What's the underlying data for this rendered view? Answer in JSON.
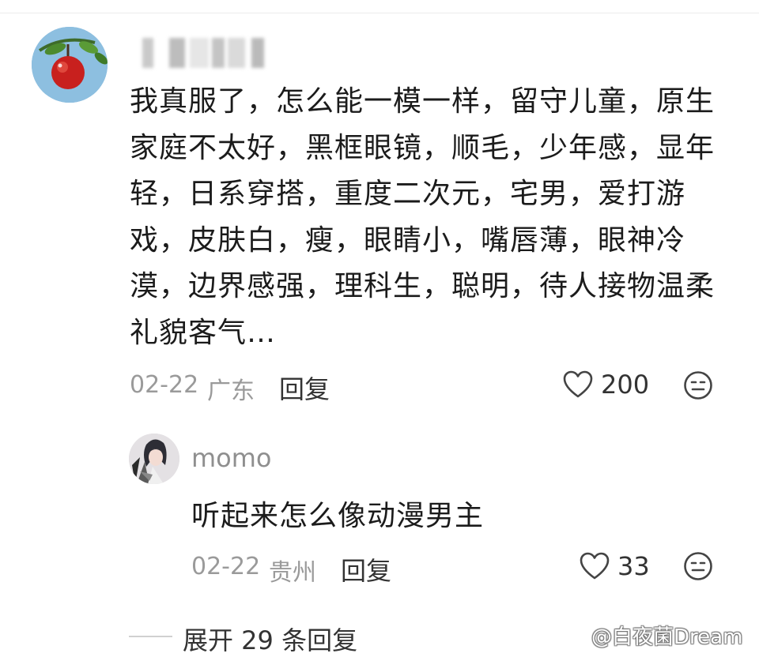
{
  "comment": {
    "text": "我真服了，怎么能一模一样，留守儿童，原生家庭不太好，黑框眼镜，顺毛，少年感，显年轻，日系穿搭，重度二次元，宅男，爱打游戏，皮肤白，瘦，眼睛小，嘴唇薄，眼神冷漠，边界感强，理科生，聪明，待人接物温柔礼貌客气…",
    "date": "02-22",
    "location": "广东",
    "reply_label": "回复",
    "likes": "200",
    "avatar_icon": "apple-avatar",
    "emoji_icon": "neutral-face-icon",
    "like_icon": "heart-outline-icon"
  },
  "reply": {
    "username": "momo",
    "text": "听起来怎么像动漫男主",
    "date": "02-22",
    "location": "贵州",
    "reply_label": "回复",
    "likes": "33",
    "avatar_icon": "anime-character-avatar"
  },
  "expand": {
    "label": "展开 29 条回复"
  },
  "watermark": {
    "text": "@白夜菌Dream"
  }
}
